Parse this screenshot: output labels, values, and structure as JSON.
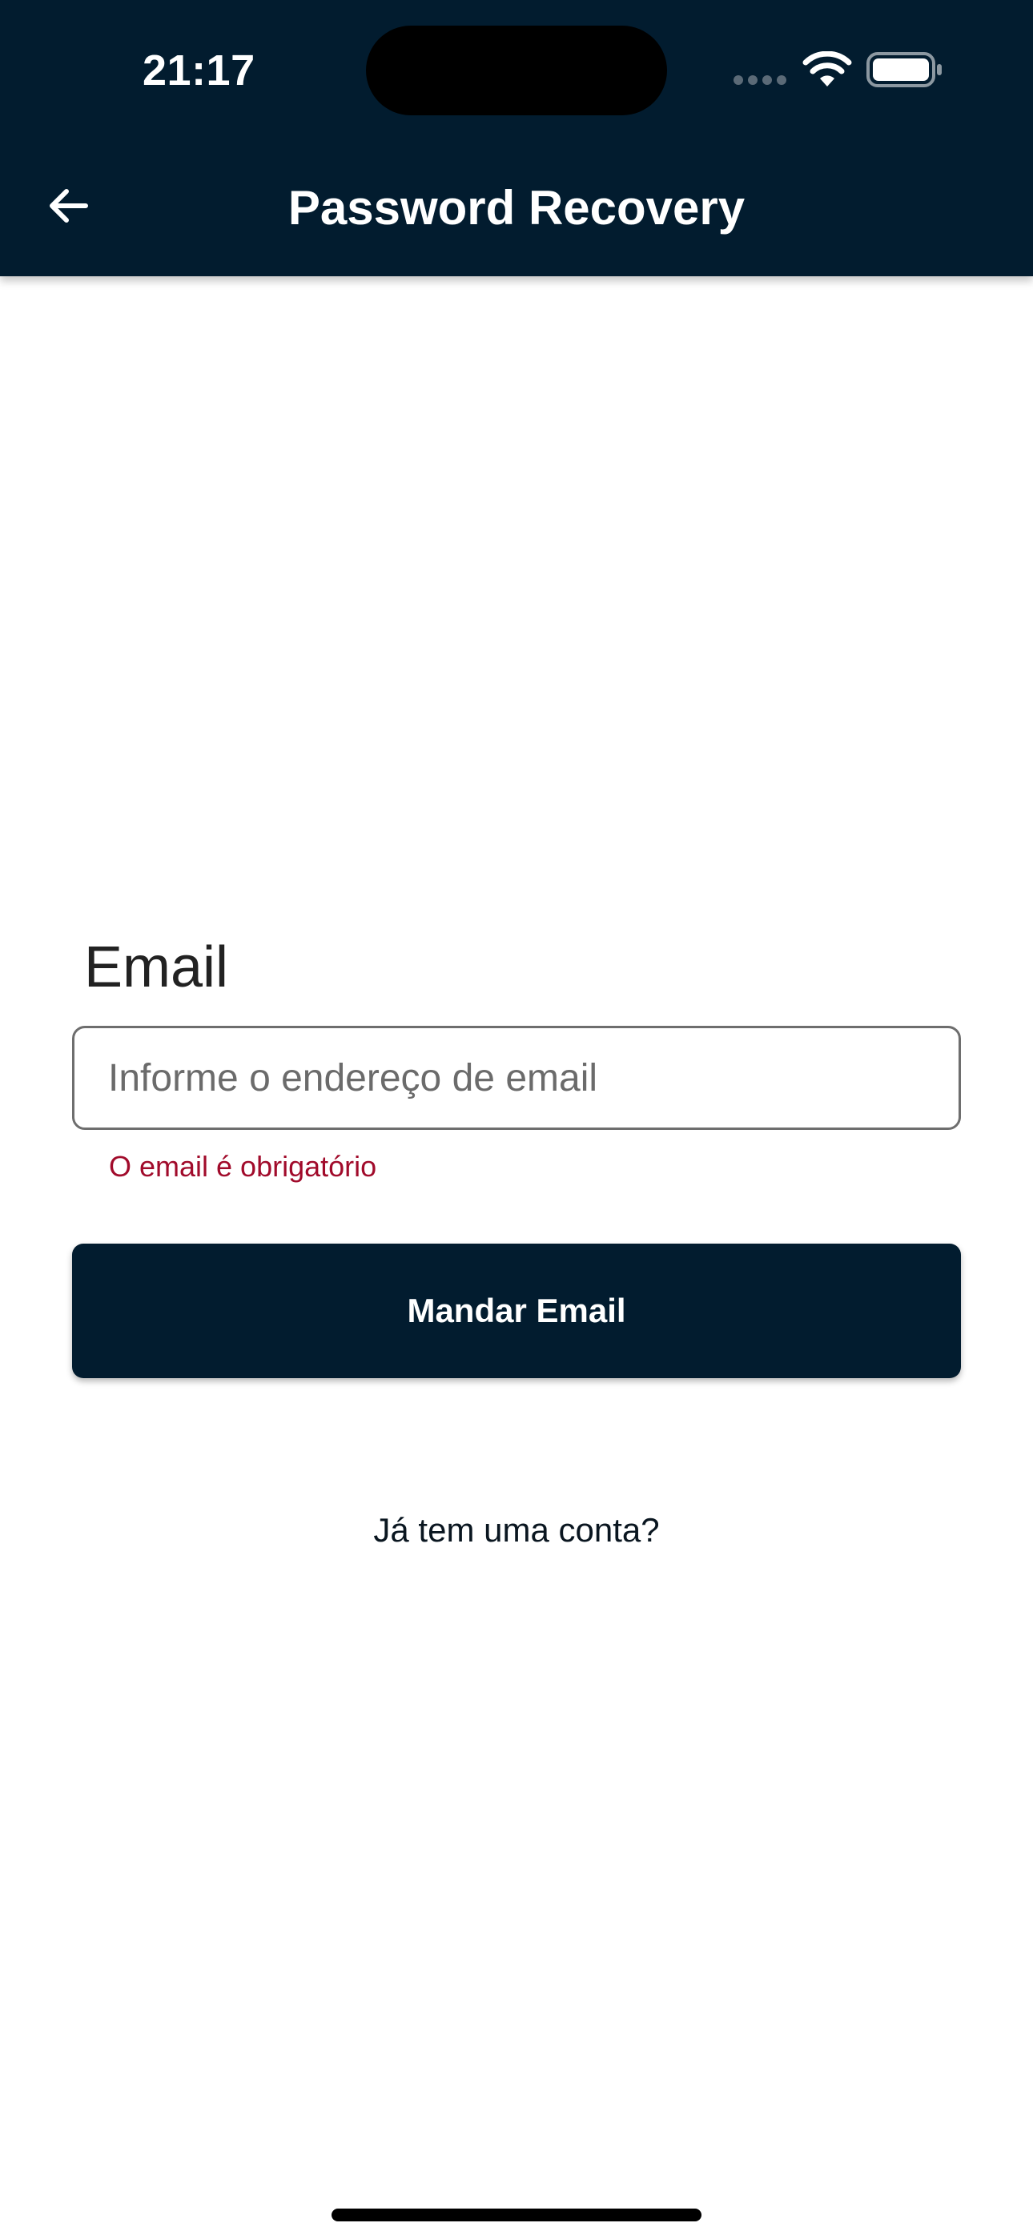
{
  "status_bar": {
    "time": "21:17"
  },
  "header": {
    "title": "Password Recovery",
    "back_icon": "arrow-left-icon",
    "background_color": "#021c2f"
  },
  "form": {
    "email_label": "Email",
    "email_value": "",
    "email_placeholder": "Informe o endereço de email",
    "error_message": "O email é obrigatório",
    "error_color": "#a10b2b",
    "submit_label": "Mandar Email",
    "submit_color": "#021c2f"
  },
  "footer": {
    "account_link": "Já tem uma conta?"
  }
}
